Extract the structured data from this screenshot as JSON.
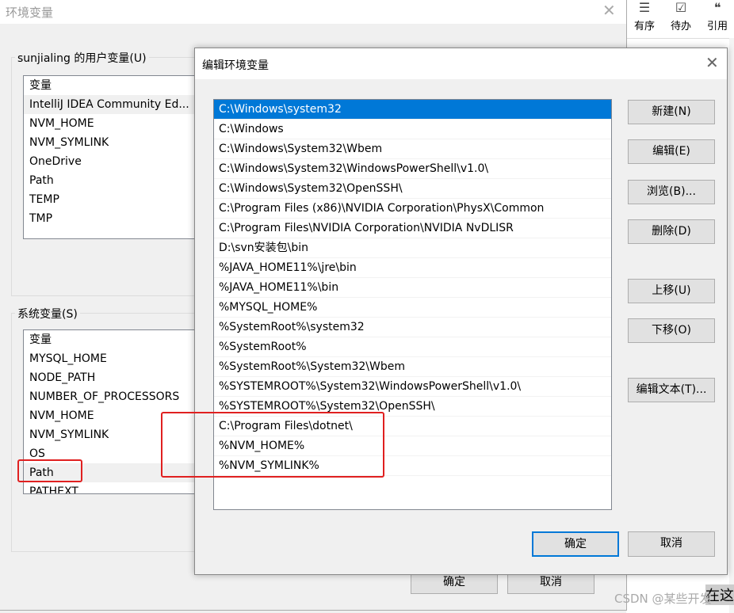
{
  "toolbar": {
    "items": [
      {
        "label": "有序",
        "icon": "ordered-list-icon"
      },
      {
        "label": "待办",
        "icon": "todo-list-icon"
      },
      {
        "label": "引用",
        "icon": "quote-icon"
      }
    ]
  },
  "env_window": {
    "title": "环境变量",
    "user_group": "sunjialing 的用户变量(U)",
    "user_header": "变量",
    "user_vars": [
      "IntelliJ IDEA Community Ed...",
      "NVM_HOME",
      "NVM_SYMLINK",
      "OneDrive",
      "Path",
      "TEMP",
      "TMP"
    ],
    "system_group": "系统变量(S)",
    "system_header": "变量",
    "system_vars": [
      "MYSQL_HOME",
      "NODE_PATH",
      "NUMBER_OF_PROCESSORS",
      "NVM_HOME",
      "NVM_SYMLINK",
      "OS",
      "Path",
      "PATHEXT"
    ],
    "ok": "确定",
    "cancel": "取消"
  },
  "edit_dialog": {
    "title": "编辑环境变量",
    "paths": [
      "C:\\Windows\\system32",
      "C:\\Windows",
      "C:\\Windows\\System32\\Wbem",
      "C:\\Windows\\System32\\WindowsPowerShell\\v1.0\\",
      "C:\\Windows\\System32\\OpenSSH\\",
      "C:\\Program Files (x86)\\NVIDIA Corporation\\PhysX\\Common",
      "C:\\Program Files\\NVIDIA Corporation\\NVIDIA NvDLISR",
      "D:\\svn安装包\\bin",
      "%JAVA_HOME11%\\jre\\bin",
      "%JAVA_HOME11%\\bin",
      "%MYSQL_HOME%",
      "%SystemRoot%\\system32",
      "%SystemRoot%",
      "%SystemRoot%\\System32\\Wbem",
      "%SYSTEMROOT%\\System32\\WindowsPowerShell\\v1.0\\",
      "%SYSTEMROOT%\\System32\\OpenSSH\\",
      "C:\\Program Files\\dotnet\\",
      "%NVM_HOME%",
      "%NVM_SYMLINK%"
    ],
    "buttons": {
      "new": "新建(N)",
      "edit": "编辑(E)",
      "browse": "浏览(B)...",
      "delete": "删除(D)",
      "up": "上移(U)",
      "down": "下移(O)",
      "edit_text": "编辑文本(T)..."
    },
    "ok": "确定",
    "cancel": "取消"
  },
  "watermark": "CSDN @某些开发",
  "bg_text": "在这",
  "colors": {
    "selection": "#0078d7",
    "highlight": "#e02020"
  }
}
